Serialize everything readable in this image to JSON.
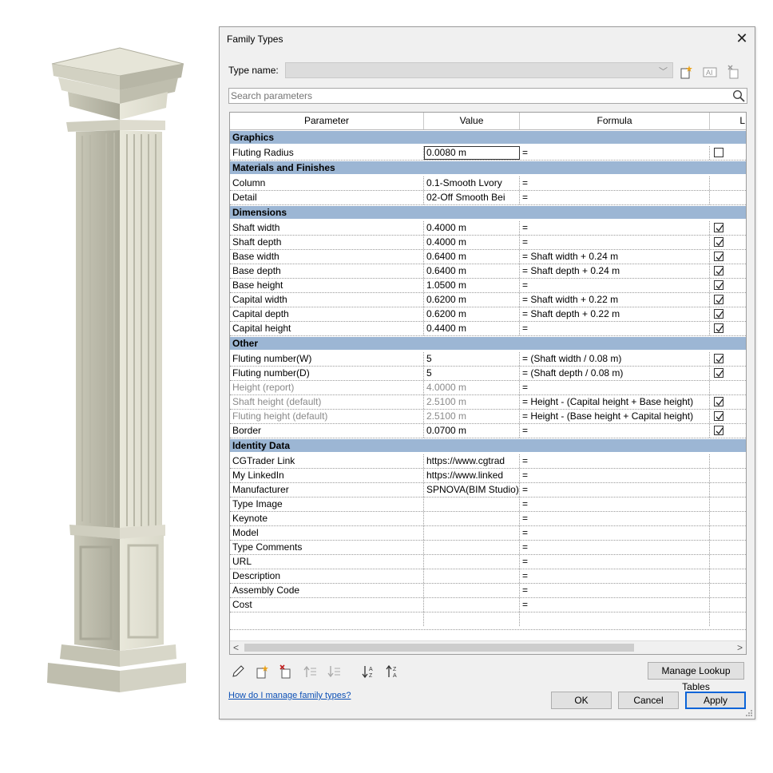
{
  "dialog": {
    "title": "Family Types",
    "type_name_label": "Type name:",
    "search_placeholder": "Search parameters",
    "columns": [
      "Parameter",
      "Value",
      "Formula",
      "L"
    ],
    "manage_lookup_label": "Manage Lookup Tables",
    "help_link": "How do I manage family types?",
    "ok_label": "OK",
    "cancel_label": "Cancel",
    "apply_label": "Apply"
  },
  "groups": [
    {
      "name": "Graphics",
      "rows": [
        {
          "param": "Fluting Radius",
          "value": "0.0080 m",
          "formula": "=",
          "lock": "unchecked",
          "active": true
        }
      ]
    },
    {
      "name": "Materials and Finishes",
      "rows": [
        {
          "param": "Column",
          "value": "0.1-Smooth Lvory",
          "formula": "=",
          "lock": "none"
        },
        {
          "param": "Detail",
          "value": "02-Off Smooth Bei",
          "formula": "=",
          "lock": "none"
        }
      ]
    },
    {
      "name": "Dimensions",
      "rows": [
        {
          "param": "Shaft width",
          "value": "0.4000 m",
          "formula": "=",
          "lock": "checked"
        },
        {
          "param": "Shaft depth",
          "value": "0.4000 m",
          "formula": "=",
          "lock": "checked"
        },
        {
          "param": "Base width",
          "value": "0.6400 m",
          "formula": "= Shaft width + 0.24 m",
          "lock": "checked"
        },
        {
          "param": "Base depth",
          "value": "0.6400 m",
          "formula": "= Shaft depth + 0.24 m",
          "lock": "checked"
        },
        {
          "param": "Base height",
          "value": "1.0500 m",
          "formula": "=",
          "lock": "checked"
        },
        {
          "param": "Capital width",
          "value": "0.6200 m",
          "formula": "= Shaft width + 0.22 m",
          "lock": "checked"
        },
        {
          "param": "Capital depth",
          "value": "0.6200 m",
          "formula": "= Shaft depth + 0.22 m",
          "lock": "checked"
        },
        {
          "param": "Capital height",
          "value": "0.4400 m",
          "formula": "=",
          "lock": "checked"
        }
      ]
    },
    {
      "name": "Other",
      "rows": [
        {
          "param": "Fluting number(W)",
          "value": "5",
          "formula": "= (Shaft width / 0.08 m)",
          "lock": "checked"
        },
        {
          "param": "Fluting number(D)",
          "value": "5",
          "formula": "= (Shaft depth / 0.08 m)",
          "lock": "checked"
        },
        {
          "param": "Height (report)",
          "value": "4.0000 m",
          "formula": "=",
          "lock": "none",
          "gray": true
        },
        {
          "param": "Shaft height (default)",
          "value": "2.5100 m",
          "formula": "= Height - (Capital height + Base height)",
          "lock": "checked",
          "gray": true
        },
        {
          "param": "Fluting height (default)",
          "value": "2.5100 m",
          "formula": "= Height - (Base height + Capital height)",
          "lock": "checked",
          "gray": true
        },
        {
          "param": "Border",
          "value": "0.0700 m",
          "formula": "=",
          "lock": "checked"
        }
      ]
    },
    {
      "name": "Identity Data",
      "rows": [
        {
          "param": "CGTrader Link",
          "value": "https://www.cgtrad",
          "formula": "=",
          "lock": "none"
        },
        {
          "param": "My LinkedIn",
          "value": "https://www.linked",
          "formula": "=",
          "lock": "none"
        },
        {
          "param": "Manufacturer",
          "value": "SPNOVA(BIM Studio)",
          "formula": "=",
          "lock": "none"
        },
        {
          "param": "Type Image",
          "value": "",
          "formula": "=",
          "lock": "none"
        },
        {
          "param": "Keynote",
          "value": "",
          "formula": "=",
          "lock": "none"
        },
        {
          "param": "Model",
          "value": "",
          "formula": "=",
          "lock": "none"
        },
        {
          "param": "Type Comments",
          "value": "",
          "formula": "=",
          "lock": "none"
        },
        {
          "param": "URL",
          "value": "",
          "formula": "=",
          "lock": "none"
        },
        {
          "param": "Description",
          "value": "",
          "formula": "=",
          "lock": "none"
        },
        {
          "param": "Assembly Code",
          "value": "",
          "formula": "=",
          "lock": "none"
        },
        {
          "param": "Cost",
          "value": "",
          "formula": "=",
          "lock": "none"
        }
      ]
    }
  ],
  "colors": {
    "group_header": "#9cb6d4",
    "default_button_border": "#0a64d8",
    "link": "#0b4fb5"
  },
  "icons": {
    "type_tools": [
      "new-type-icon",
      "rename-type-icon",
      "delete-type-icon"
    ],
    "bottom_tools": [
      "edit-parameter-icon",
      "new-parameter-icon",
      "delete-parameter-icon",
      "move-up-icon",
      "move-down-icon",
      "sort-ascending-icon",
      "sort-descending-icon"
    ]
  }
}
